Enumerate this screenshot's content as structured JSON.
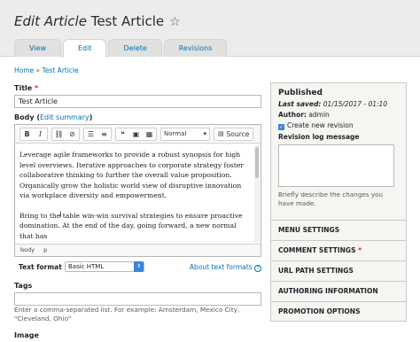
{
  "header": {
    "title_prefix": "Edit Article",
    "title_name": "Test Article",
    "star_icon": "☆"
  },
  "tabs": [
    {
      "label": "View",
      "active": false
    },
    {
      "label": "Edit",
      "active": true
    },
    {
      "label": "Delete",
      "active": false
    },
    {
      "label": "Revisions",
      "active": false
    }
  ],
  "breadcrumb": {
    "home": "Home",
    "separator": "»",
    "current": "Test Article"
  },
  "title_field": {
    "label": "Title",
    "required_mark": "*",
    "value": "Test Article"
  },
  "body_field": {
    "label": "Body (",
    "edit_summary_link": "Edit summary",
    "label_close": ")",
    "toolbar": {
      "bold": "B",
      "italic": "I",
      "link_icon": "⛓",
      "unlink_icon": "⊘",
      "bullet_list_icon": "☰",
      "numbered_list_icon": "≡",
      "blockquote_icon": "❝",
      "image_icon": "▣",
      "table_icon": "▦",
      "format_value": "Normal",
      "format_arrow": "▾",
      "source_label": "Source",
      "source_icon": "▤"
    },
    "paragraphs": [
      "Leverage agile frameworks to provide a robust synopsis for high level overviews. Iterative approaches to corporate strategy foster collaborative thinking to further the overall value proposition. Organically grow the holistic world view of disruptive innovation via workplace diversity and empowerment.",
      "Bring to the table win-win survival strategies to ensure proactive domination. At the end of the day, going forward, a new normal that has"
    ],
    "text_cursor": "I",
    "path": [
      "body",
      "p"
    ]
  },
  "text_format": {
    "label": "Text format",
    "value": "Basic HTML",
    "arrow": "⇕",
    "about_link": "About text formats",
    "help_icon": "?"
  },
  "tags_field": {
    "label": "Tags",
    "value": "",
    "description": "Enter a comma-separated list. For example: Amsterdam, Mexico City, \"Cleveland, Ohio\""
  },
  "image_field": {
    "label": "Image"
  },
  "sidebar": {
    "status": "Published",
    "last_saved_label": "Last saved:",
    "last_saved_value": "01/15/2017 - 01:10",
    "author_label": "Author:",
    "author_value": "admin",
    "create_revision_label": "Create new revision",
    "create_revision_checked": true,
    "check_mark": "✓",
    "log_label": "Revision log message",
    "log_value": "",
    "log_description": "Briefly describe the changes you have made.",
    "sections": [
      {
        "label": "MENU SETTINGS",
        "required": false
      },
      {
        "label": "COMMENT SETTINGS",
        "required": true
      },
      {
        "label": "URL PATH SETTINGS",
        "required": false
      },
      {
        "label": "AUTHORING INFORMATION",
        "required": false
      },
      {
        "label": "PROMOTION OPTIONS",
        "required": false
      }
    ],
    "required_mark": "*"
  },
  "colors": {
    "link": "#0071b8",
    "required": "#e62600",
    "select_accent": "#3a84d9"
  }
}
